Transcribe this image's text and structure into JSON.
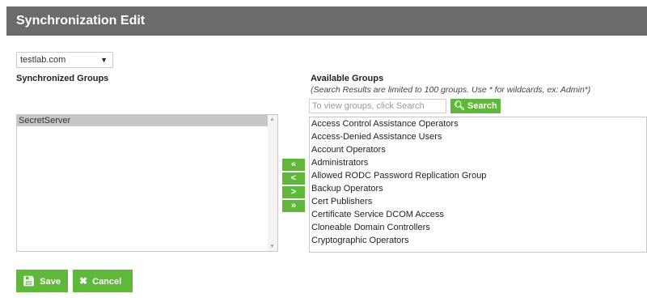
{
  "header": {
    "title": "Synchronization Edit"
  },
  "domain_select": {
    "selected": "testlab.com"
  },
  "synchronized": {
    "label": "Synchronized Groups",
    "items": [
      "SecretServer"
    ]
  },
  "available": {
    "label": "Available Groups",
    "hint": "(Search Results are limited to 100 groups. Use * for wildcards, ex: Admin*)",
    "search_placeholder": "To view groups, click Search",
    "search_button": "Search",
    "items": [
      "Access Control Assistance Operators",
      "Access-Denied Assistance Users",
      "Account Operators",
      "Administrators",
      "Allowed RODC Password Replication Group",
      "Backup Operators",
      "Cert Publishers",
      "Certificate Service DCOM Access",
      "Cloneable Domain Controllers",
      "Cryptographic Operators"
    ]
  },
  "move_buttons": {
    "all_left": "«",
    "left": "<",
    "right": ">",
    "all_right": "»"
  },
  "actions": {
    "save": "Save",
    "cancel": "Cancel"
  },
  "colors": {
    "accent": "#5fb73b",
    "titlebar": "#6b6b6b"
  }
}
